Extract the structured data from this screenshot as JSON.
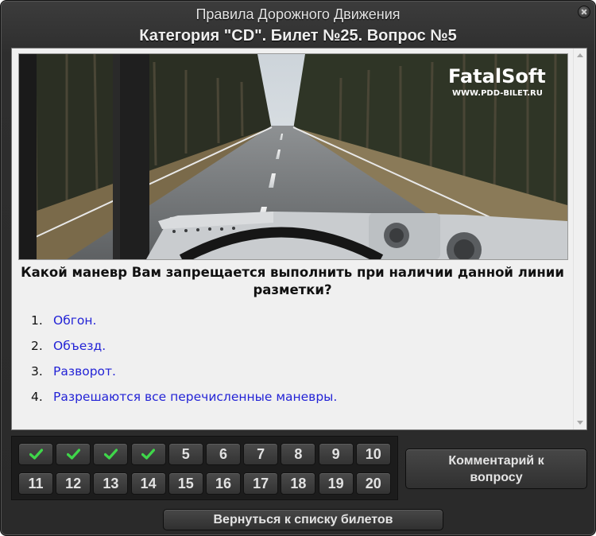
{
  "window": {
    "title_line1": "Правила Дорожного Движения",
    "title_line2": "Категория \"CD\". Билет №25. Вопрос №5"
  },
  "image": {
    "logo_brand": "FatalSoft",
    "logo_url": "WWW.PDD-BILET.RU"
  },
  "question": {
    "text": "Какой маневр Вам запрещается выполнить при наличии данной линии разметки?"
  },
  "answers": [
    {
      "num": "1.",
      "text": "Обгон."
    },
    {
      "num": "2.",
      "text": "Объезд."
    },
    {
      "num": "3.",
      "text": "Разворот."
    },
    {
      "num": "4.",
      "text": "Разрешаются все перечисленные маневры."
    }
  ],
  "question_grid": [
    {
      "label": "",
      "answered": true,
      "icon": "check-icon",
      "color": "#3fd64a"
    },
    {
      "label": "",
      "answered": true,
      "icon": "check-icon",
      "color": "#3fd64a"
    },
    {
      "label": "",
      "answered": true,
      "icon": "check-icon",
      "color": "#3fd64a"
    },
    {
      "label": "",
      "answered": true,
      "icon": "check-icon",
      "color": "#3fd64a"
    },
    {
      "label": "5",
      "answered": false
    },
    {
      "label": "6",
      "answered": false
    },
    {
      "label": "7",
      "answered": false
    },
    {
      "label": "8",
      "answered": false
    },
    {
      "label": "9",
      "answered": false
    },
    {
      "label": "10",
      "answered": false
    },
    {
      "label": "11",
      "answered": false
    },
    {
      "label": "12",
      "answered": false
    },
    {
      "label": "13",
      "answered": false
    },
    {
      "label": "14",
      "answered": false
    },
    {
      "label": "15",
      "answered": false
    },
    {
      "label": "16",
      "answered": false
    },
    {
      "label": "17",
      "answered": false
    },
    {
      "label": "18",
      "answered": false
    },
    {
      "label": "19",
      "answered": false
    },
    {
      "label": "20",
      "answered": false
    }
  ],
  "buttons": {
    "comment_line1": "Комментарий к",
    "comment_line2": "вопросу",
    "back": "Вернуться к списку билетов"
  },
  "colors": {
    "answer_text": "#2323d6",
    "check": "#3fd64a",
    "window_bg": "#2e2e2e"
  }
}
